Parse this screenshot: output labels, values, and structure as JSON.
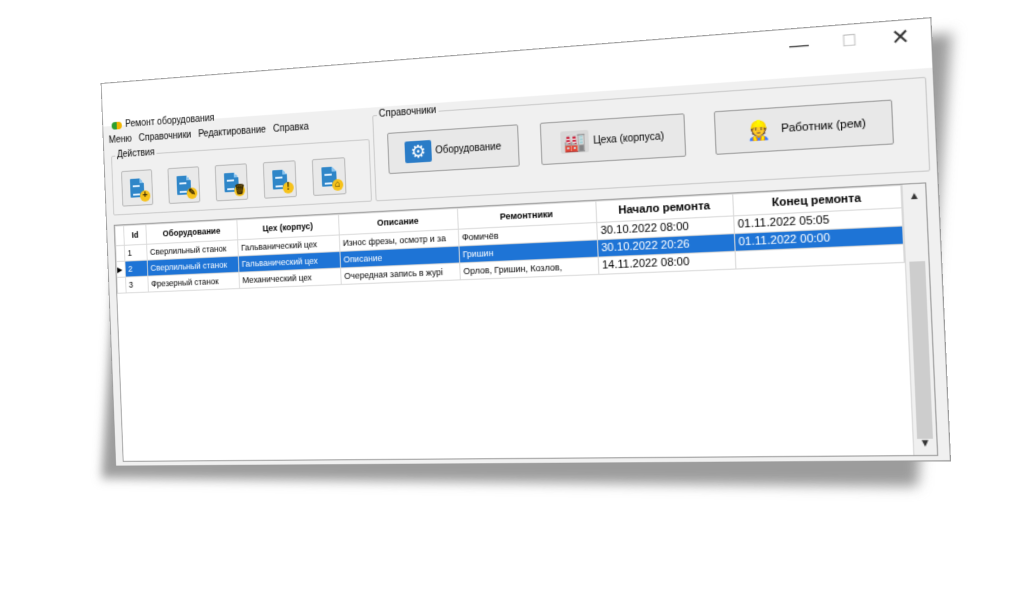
{
  "window": {
    "title": "Ремонт оборудования",
    "controls": {
      "minimize": "—",
      "maximize": "☐",
      "close": "✕"
    }
  },
  "menu": [
    "Меню",
    "Справочники",
    "Редактирование",
    "Справка"
  ],
  "actions": {
    "title": "Действия",
    "buttons": [
      {
        "icon": "add-doc-icon",
        "badge": "+"
      },
      {
        "icon": "edit-doc-icon",
        "badge": "✎"
      },
      {
        "icon": "delete-doc-icon",
        "badge": "🗑"
      },
      {
        "icon": "warning-doc-icon",
        "badge": "!"
      },
      {
        "icon": "home-doc-icon",
        "badge": "⌂"
      }
    ]
  },
  "references": {
    "title": "Справочники",
    "buttons": [
      {
        "label": "Оборудование",
        "icon": "equipment-icon"
      },
      {
        "label": "Цеха (корпуса)",
        "icon": "factory-icon"
      },
      {
        "label": "Работник (рем)",
        "icon": "workers-icon"
      }
    ]
  },
  "table": {
    "columns": [
      "Id",
      "Оборудование",
      "Цех (корпус)",
      "Описание",
      "Ремонтники",
      "Начало ремонта",
      "Конец ремонта"
    ],
    "rows": [
      {
        "id": "1",
        "equipment": "Сверлильный станок",
        "shop": "Гальванический цех",
        "description": "Износ фрезы, осмотр и за",
        "repairers": "Фомичёв",
        "start": "30.10.2022 08:00",
        "end": "01.11.2022 05:05",
        "selected": false
      },
      {
        "id": "2",
        "equipment": "Сверлильный станок",
        "shop": "Гальванический цех",
        "description": "Описание",
        "repairers": "Гришин",
        "start": "30.10.2022 20:26",
        "end": "01.11.2022 00:00",
        "selected": true
      },
      {
        "id": "3",
        "equipment": "Фрезерный станок",
        "shop": "Механический цех",
        "description": "Очередная запись в журі",
        "repairers": "Орлов, Гришин, Козлов,",
        "start": "14.11.2022 08:00",
        "end": "",
        "selected": false
      }
    ]
  },
  "colors": {
    "selection": "#1e74d6",
    "window_bg": "#f0f0f0"
  }
}
